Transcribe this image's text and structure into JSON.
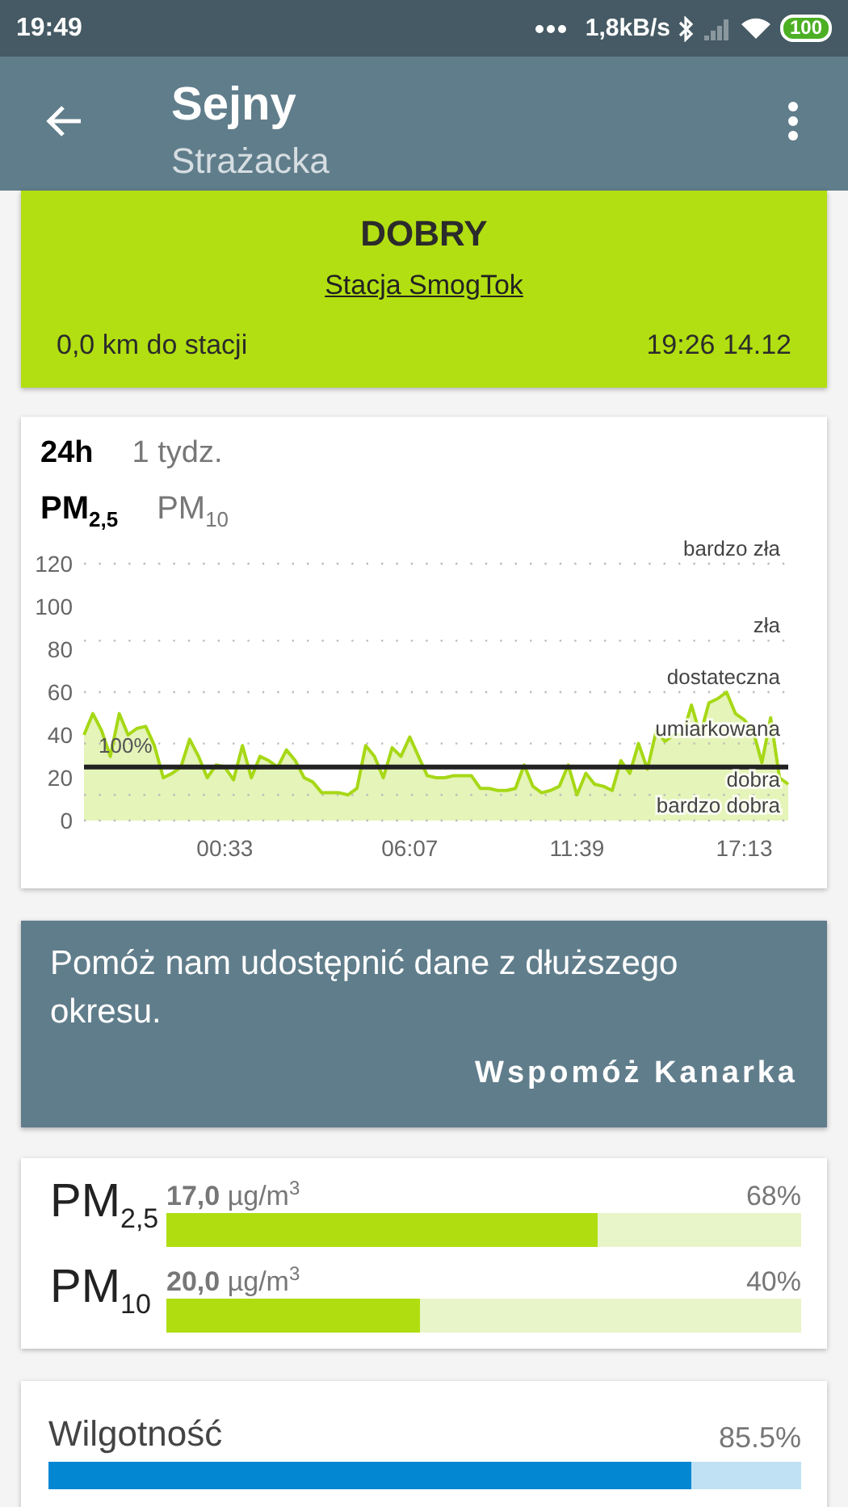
{
  "status_bar": {
    "time": "19:49",
    "speed": "1,8kB/s",
    "battery": "100"
  },
  "app_bar": {
    "title": "Sejny",
    "subtitle": "Strażacka"
  },
  "quality": {
    "rating": "DOBRY",
    "station_link": "Stacja SmogTok",
    "distance": "0,0 km do stacji",
    "updated": "19:26 14.12"
  },
  "chart_card": {
    "periods": [
      {
        "label": "24h",
        "selected": true
      },
      {
        "label": "1 tydz.",
        "selected": false
      }
    ],
    "pollutants": [
      {
        "label": "PM$_{2,5}$",
        "selected": true
      },
      {
        "label": "PM$_{10}$",
        "selected": false
      }
    ],
    "chart_data": {
      "type": "area",
      "categories": [
        null,
        null,
        null,
        null,
        null,
        null,
        null,
        null,
        null,
        null,
        null,
        null,
        null,
        null,
        null,
        null,
        "00:33",
        null,
        null,
        null,
        null,
        null,
        null,
        null,
        null,
        null,
        null,
        null,
        null,
        null,
        null,
        null,
        null,
        null,
        null,
        null,
        null,
        "06:07",
        null,
        null,
        null,
        null,
        null,
        null,
        null,
        null,
        null,
        null,
        null,
        null,
        null,
        null,
        null,
        null,
        null,
        null,
        "11:39",
        null,
        null,
        null,
        null,
        null,
        null,
        null,
        null,
        null,
        null,
        null,
        null,
        null,
        null,
        null,
        null,
        null,
        null,
        "17:13",
        null,
        null,
        null,
        null,
        null
      ],
      "ylim": [
        0,
        120
      ],
      "yticks": [
        0,
        20,
        40,
        60,
        80,
        100,
        120
      ],
      "series": [
        {
          "color": "#a6d816",
          "values": [
            40,
            50,
            42,
            30,
            50,
            40,
            43,
            44,
            35,
            20,
            22,
            25,
            38,
            30,
            20,
            26,
            25,
            19,
            35,
            20,
            30,
            28,
            25,
            33,
            28,
            20,
            18,
            13,
            13,
            13,
            12,
            15,
            35,
            30,
            20,
            34,
            30,
            39,
            30,
            21,
            20,
            20,
            21,
            21,
            21,
            15,
            15,
            14,
            14,
            15,
            26,
            16,
            13,
            14,
            16,
            26,
            12,
            22,
            17,
            16,
            14,
            28,
            22,
            36,
            24,
            42,
            37,
            40,
            40,
            54,
            40,
            55,
            57,
            60,
            50,
            47,
            42,
            27,
            48,
            20,
            17
          ]
        },
        {
          "name": "100%",
          "type": "line",
          "color": "#222222",
          "values": [
            25,
            25,
            25,
            25,
            25,
            25,
            25,
            25,
            25,
            25,
            25,
            25,
            25,
            25,
            25,
            25,
            25,
            25,
            25,
            25,
            25,
            25,
            25,
            25,
            25,
            25,
            25,
            25,
            25,
            25,
            25,
            25,
            25,
            25,
            25,
            25,
            25,
            25,
            25,
            25,
            25,
            25,
            25,
            25,
            25,
            25,
            25,
            25,
            25,
            25,
            25,
            25,
            25,
            25,
            25,
            25,
            25,
            25,
            25,
            25,
            25,
            25,
            25,
            25,
            25,
            25,
            25,
            25,
            25,
            25,
            25,
            25,
            25,
            25,
            25,
            25,
            25,
            25,
            25,
            25,
            25
          ]
        }
      ],
      "annotations": [
        "bardzo zła",
        "zła",
        "dostateczna",
        "umiarkowana",
        "dobra",
        "bardzo dobra"
      ]
    }
  },
  "promo": {
    "message": "Pomóż nam udostępnić dane z dłuższego okresu.",
    "action": "Wspomóż Kanarka"
  },
  "measurements": [
    {
      "label": "PM$_{2,5}$",
      "value": "**17,0** µg/m$^{3}$",
      "percent": "68%",
      "level": 0.68
    },
    {
      "label": "PM$_{10}$",
      "value": "**20,0** µg/m$^{3}$",
      "percent": "40%",
      "level": 0.4
    }
  ],
  "humidity": {
    "label": "Wilgotność",
    "value": "85.5%",
    "level": 0.855
  }
}
